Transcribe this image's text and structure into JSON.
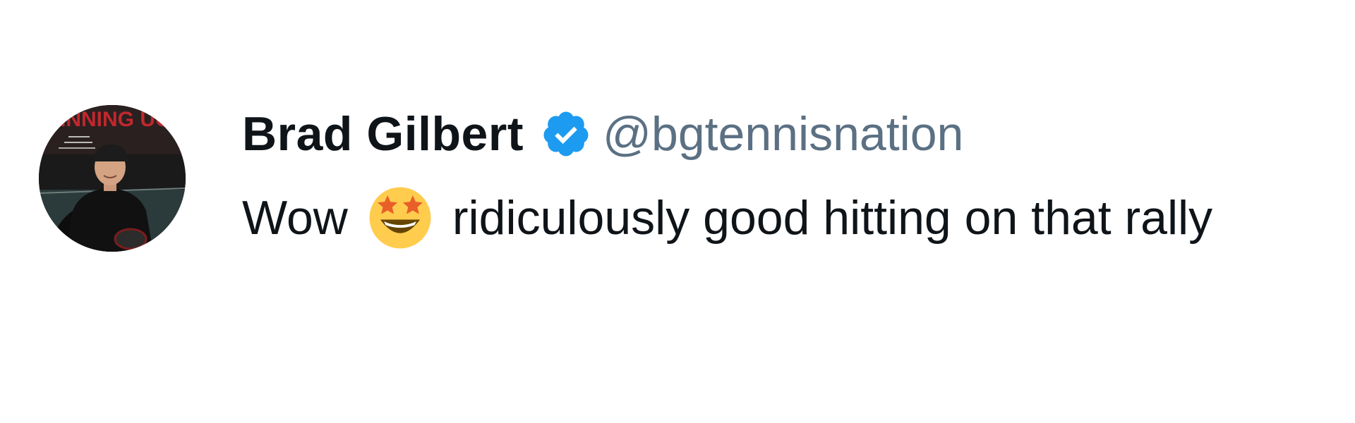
{
  "tweet": {
    "avatar": {
      "icon": "profile-photo-icon",
      "book_title_partial": "INNING UG"
    },
    "author": {
      "display_name": "Brad Gilbert",
      "handle": "@bgtennisnation",
      "verified": true,
      "badge_icon": "verified-badge-icon",
      "badge_color": "#1d9bf0"
    },
    "text": {
      "before_emoji": "Wow",
      "emoji": "star-struck-emoji-icon",
      "after_emoji": "ridiculously good hitting on that rally"
    }
  },
  "colors": {
    "name": "#0f1419",
    "handle": "#5b7083",
    "body_text": "#0f1419",
    "background": "#ffffff"
  }
}
